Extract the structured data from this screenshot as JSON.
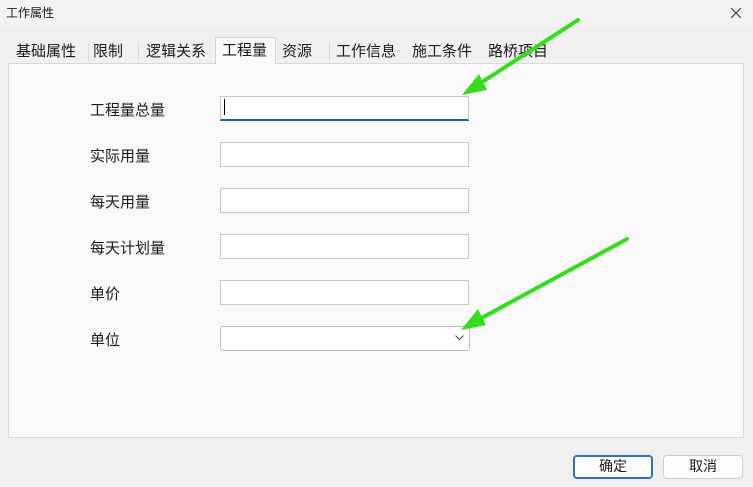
{
  "window": {
    "title": "工作属性",
    "close_glyph": "✕"
  },
  "tabs": [
    {
      "label": "基础属性",
      "active": false
    },
    {
      "label": "限制",
      "active": false
    },
    {
      "label": "逻辑关系",
      "active": false
    },
    {
      "label": "工程量",
      "active": true
    },
    {
      "label": "资源",
      "active": false
    },
    {
      "label": "工作信息",
      "active": false
    },
    {
      "label": "施工条件",
      "active": false
    },
    {
      "label": "路桥项目",
      "active": false
    }
  ],
  "form": {
    "fields": [
      {
        "label": "工程量总量",
        "value": "",
        "focused": true
      },
      {
        "label": "实际用量",
        "value": ""
      },
      {
        "label": "每天用量",
        "value": ""
      },
      {
        "label": "每天计划量",
        "value": ""
      },
      {
        "label": "单价",
        "value": ""
      }
    ],
    "unit": {
      "label": "单位",
      "selected": ""
    }
  },
  "buttons": {
    "ok": "确定",
    "cancel": "取消"
  },
  "annotations": {
    "arrow_color": "#33dd1c"
  }
}
